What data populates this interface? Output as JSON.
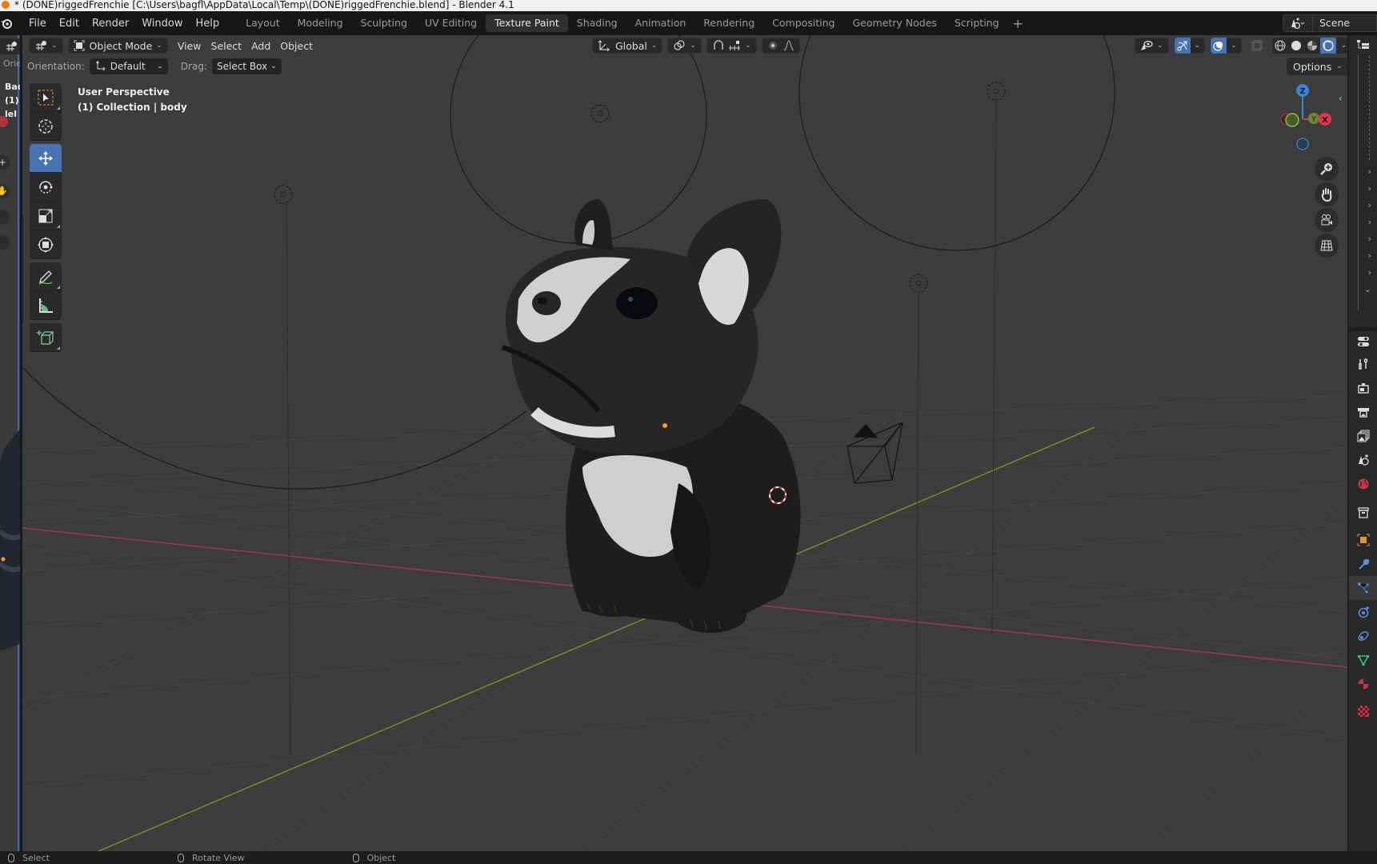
{
  "window": {
    "title": "* (DONE)riggedFrenchie [C:\\Users\\bagfl\\AppData\\Local\\Temp\\(DONE)riggedFrenchie.blend] - Blender 4.1"
  },
  "topbar": {
    "menus": [
      "File",
      "Edit",
      "Render",
      "Window",
      "Help"
    ],
    "workspaces": [
      "Layout",
      "Modeling",
      "Sculpting",
      "UV Editing",
      "Texture Paint",
      "Shading",
      "Animation",
      "Rendering",
      "Compositing",
      "Geometry Nodes",
      "Scripting"
    ],
    "active_workspace": "Texture Paint",
    "add_workspace": "+",
    "scene_name": "Scene"
  },
  "viewport_header": {
    "editor_type_icon": "3d-viewport-icon",
    "mode": "Object Mode",
    "menus": [
      "View",
      "Select",
      "Add",
      "Object"
    ],
    "transform_orientation": "Global",
    "pivot_icon": "pivot-icon",
    "snap_icon": "snap-magnet-icon",
    "proportional_icon": "proportional-edit-icon",
    "falloff_icon": "falloff-curve-icon",
    "visibility_icon": "eye-selectable-icon",
    "gizmo_icon": "gizmo-toggle-icon",
    "overlay_icon": "overlay-toggle-icon",
    "xray_icon": "xray-icon",
    "shading_modes": [
      "wireframe",
      "solid",
      "material-preview",
      "rendered"
    ],
    "active_shading": "rendered"
  },
  "tool_settings": {
    "cut_label": "Orie",
    "orientation_label": "Orientation:",
    "orientation_value": "Default",
    "drag_label": "Drag:",
    "drag_value": "Select Box",
    "options_label": "Options"
  },
  "toolbar": {
    "tools": [
      {
        "name": "select-box",
        "active": false
      },
      {
        "name": "cursor",
        "active": false
      },
      {
        "name": "move",
        "active": true
      },
      {
        "name": "rotate",
        "active": false
      },
      {
        "name": "scale",
        "active": false
      },
      {
        "name": "transform",
        "active": false
      },
      {
        "name": "annotate",
        "active": false
      },
      {
        "name": "measure",
        "active": false
      },
      {
        "name": "add-cube",
        "active": false
      }
    ]
  },
  "viewport_overlay": {
    "view_name": "User Perspective",
    "collection_info": "(1) Collection | body"
  },
  "left_strip": {
    "text_lines": [
      "Bac",
      "(1)",
      "lel"
    ]
  },
  "nav_gizmo": {
    "axes": {
      "x": "X",
      "y": "Y",
      "z": "Z"
    },
    "colors": {
      "x": "#e2344e",
      "y": "#8bc43f",
      "z": "#3b82d8"
    }
  },
  "statusbar": {
    "items": [
      "Select",
      "Rotate View",
      "Object"
    ]
  },
  "colors": {
    "accent_blue": "#4772b3",
    "viewport_bg": "#3c3c3c",
    "x_axis_line": "#9b3a46",
    "y_axis_line": "#6f8f2a"
  }
}
